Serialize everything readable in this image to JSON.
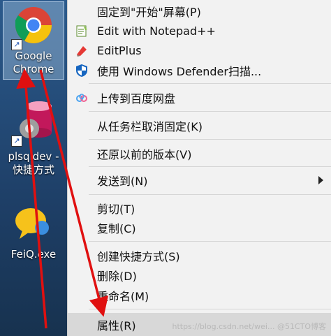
{
  "desktop": {
    "icons": [
      {
        "label_line1": "Google",
        "label_line2": "Chrome"
      },
      {
        "label_line1": "plsqldev -",
        "label_line2": "快捷方式"
      },
      {
        "label_line1": "FeiQ.exe"
      }
    ]
  },
  "context_menu": {
    "items": [
      {
        "label": "固定到\"开始\"屏幕(P)"
      },
      {
        "label": "Edit with Notepad++"
      },
      {
        "label": "EditPlus"
      },
      {
        "label": "使用 Windows Defender扫描..."
      },
      {
        "label": "上传到百度网盘"
      },
      {
        "label": "从任务栏取消固定(K)"
      },
      {
        "label": "还原以前的版本(V)"
      },
      {
        "label": "发送到(N)"
      },
      {
        "label": "剪切(T)"
      },
      {
        "label": "复制(C)"
      },
      {
        "label": "创建快捷方式(S)"
      },
      {
        "label": "删除(D)"
      },
      {
        "label": "重命名(M)"
      },
      {
        "label": "属性(R)"
      }
    ]
  },
  "watermark": "https://blog.csdn.net/wei... @51CTO博客",
  "colors": {
    "menu_bg": "#f2f2f2",
    "highlight": "#d8d8d8",
    "arrow": "#e01010"
  }
}
